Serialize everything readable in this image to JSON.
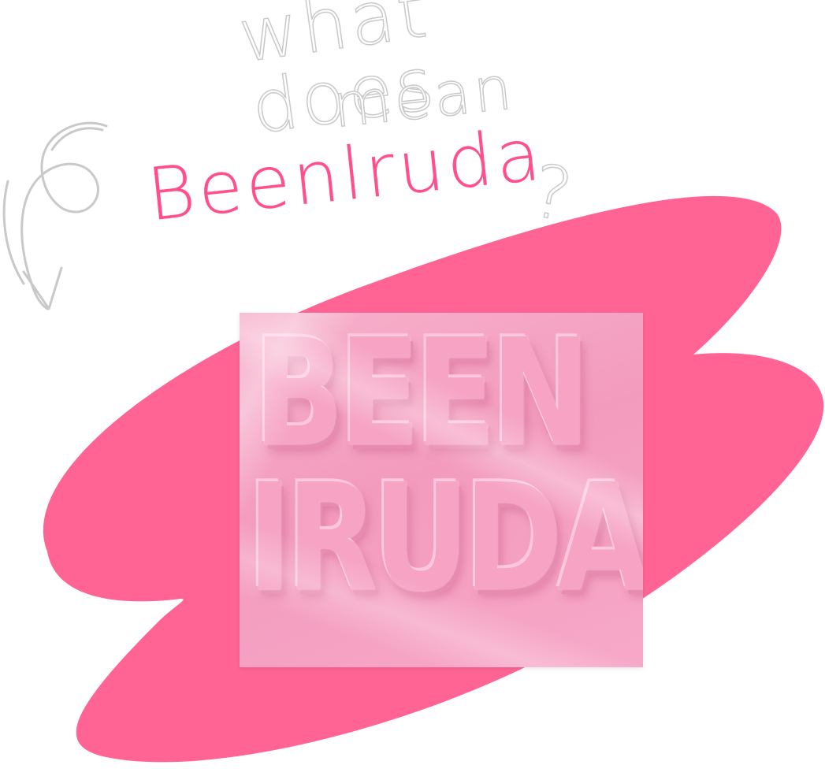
{
  "artwork": {
    "question_line1": "what does",
    "question_line2": "mean",
    "brand_word": "Beenlruda",
    "question_mark": "?"
  },
  "cover": {
    "title_line1": "BEEN",
    "title_line2": "IRUDA"
  },
  "colors": {
    "blob": "#ff6494",
    "brand_text": "#ff4f8c",
    "sketch_outline": "#c9c9c9",
    "cover_pink": "#f39bbd",
    "balloon_pink": "#f6a3c4"
  }
}
